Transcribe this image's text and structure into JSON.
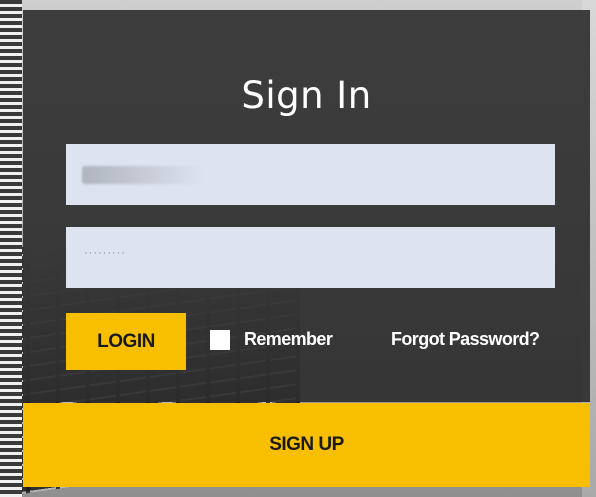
{
  "title": "Sign In",
  "username": {
    "value": "",
    "placeholder": ""
  },
  "password": {
    "masked_value": "·········"
  },
  "login_button": "LOGIN",
  "remember": {
    "label": "Remember",
    "checked": false
  },
  "forgot_password": "Forgot Password?",
  "signup_button": "SIGN UP",
  "colors": {
    "panel": "#3b3b3b",
    "accent": "#f7bf00",
    "field": "#dde3ef"
  }
}
